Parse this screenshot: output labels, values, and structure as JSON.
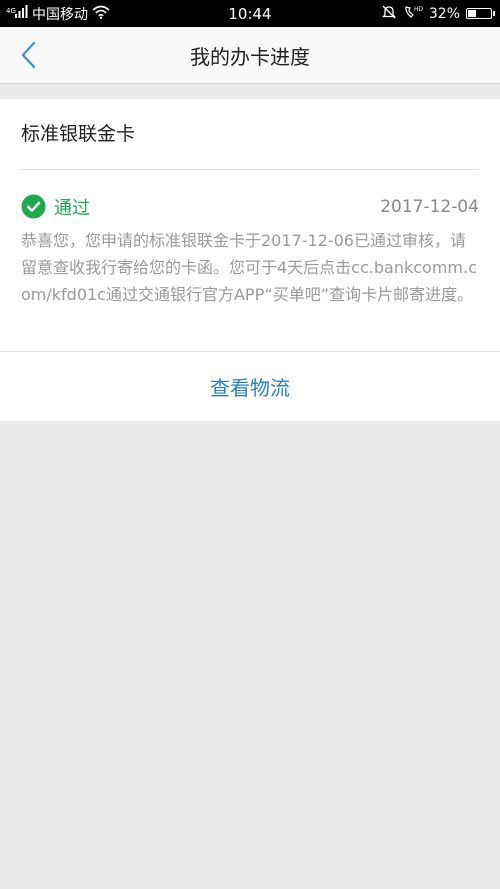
{
  "status_bar": {
    "carrier": "中国移动",
    "time": "10:44",
    "battery_percent": "32%",
    "battery_level": 0.32,
    "icons": [
      "signal-icon",
      "wifi-icon",
      "mute-bell-icon",
      "hd-call-icon",
      "battery-icon"
    ]
  },
  "nav": {
    "title": "我的办卡进度",
    "back_icon": "chevron-left-icon"
  },
  "card": {
    "name": "标准银联金卡",
    "status": {
      "label": "通过",
      "date": "2017-12-04",
      "icon": "check-circle-icon",
      "color": "#1faa4e"
    },
    "message": "恭喜您，您申请的标准银联金卡于2017-12-06已通过审核，请留意查收我行寄给您的卡函。您可于4天后点击cc.bankcomm.com/kfd01c通过交通银行官方APP“买单吧”查询卡片邮寄进度。",
    "action_label": "查看物流",
    "action_color": "#2a7fc0"
  }
}
